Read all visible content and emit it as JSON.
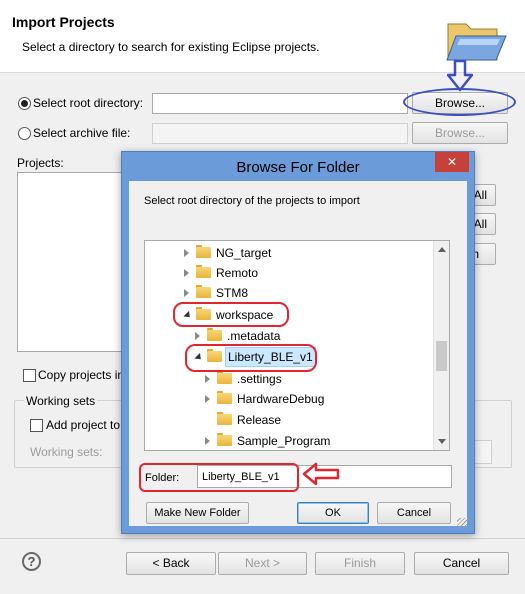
{
  "wizard": {
    "title": "Import Projects",
    "subtitle": "Select a directory to search for existing Eclipse projects.",
    "root_dir_label": "Select root directory:",
    "root_dir_value": "",
    "archive_label": "Select archive file:",
    "archive_value": "",
    "browse_label": "Browse...",
    "browse2_label": "Browse...",
    "projects_label": "Projects:",
    "select_all_fragment": "All",
    "deselect_all_fragment": "All",
    "refresh_fragment": "h",
    "copy_projects_label": "Copy projects in",
    "working_sets_legend": "Working sets",
    "add_project_label": "Add project to",
    "working_sets_label": "Working sets:",
    "help_icon": "?",
    "back_label": "< Back",
    "next_label": "Next >",
    "finish_label": "Finish",
    "cancel_label": "Cancel"
  },
  "dialog": {
    "title": "Browse For Folder",
    "close_glyph": "✕",
    "instruction": "Select root directory of the projects to import",
    "tree": [
      {
        "label": "NG_target"
      },
      {
        "label": "Remoto"
      },
      {
        "label": "STM8"
      },
      {
        "label": "workspace"
      },
      {
        "label": ".metadata"
      },
      {
        "label": "Liberty_BLE_v1"
      },
      {
        "label": ".settings"
      },
      {
        "label": "HardwareDebug"
      },
      {
        "label": "Release"
      },
      {
        "label": "Sample_Program"
      }
    ],
    "folder_label": "Folder:",
    "folder_value": "Liberty_BLE_v1",
    "make_new_folder_label": "Make New Folder",
    "ok_label": "OK",
    "cancel_label": "Cancel"
  },
  "colors": {
    "dialog_frame": "#6b9bd8",
    "selection": "#cce8ff",
    "annotation_red": "#e0262f",
    "annotation_blue": "#3a4fc4"
  },
  "icons": [
    "folder-open-icon",
    "arrow-down-icon",
    "arrow-left-icon",
    "help-icon",
    "close-icon",
    "folder-icon",
    "expand-icon",
    "collapse-icon"
  ]
}
